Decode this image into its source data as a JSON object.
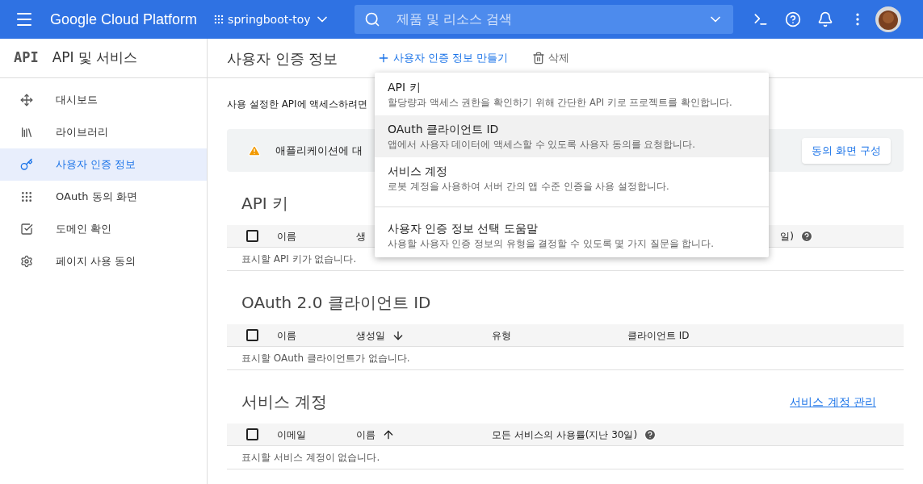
{
  "topbar": {
    "brand": "Google Cloud Platform",
    "project": "springboot-toy",
    "search": {
      "placeholder": "제품 및 리소스 검색"
    }
  },
  "sidebar": {
    "logo": "API",
    "title": "API 및 서비스",
    "items": [
      {
        "label": "대시보드",
        "selected": false
      },
      {
        "label": "라이브러리",
        "selected": false
      },
      {
        "label": "사용자 인증 정보",
        "selected": true
      },
      {
        "label": "OAuth 동의 화면",
        "selected": false
      },
      {
        "label": "도메인 확인",
        "selected": false
      },
      {
        "label": "페이지 사용 동의",
        "selected": false
      }
    ]
  },
  "page": {
    "title": "사용자 인증 정보",
    "actions": [
      {
        "kind": "create",
        "label": "사용자 인증 정보 만들기"
      },
      {
        "kind": "delete",
        "label": "삭제"
      }
    ],
    "intro": "사용 설정한 API에 액세스하려면",
    "banner": {
      "text": "애플리케이션에 대",
      "button": "동의 화면 구성"
    },
    "sections": [
      {
        "title": "API 키",
        "all_selected": false,
        "columns": [
          {
            "label": "이름"
          },
          {
            "label": "생"
          },
          {
            "label": "일)",
            "help": true
          }
        ],
        "empty": "표시할 API 키가 없습니다."
      },
      {
        "title": "OAuth 2.0 클라이언트 ID",
        "all_selected": false,
        "columns": [
          {
            "label": "이름"
          },
          {
            "label": "생성일",
            "sorted": true,
            "descending": true
          },
          {
            "label": "유형"
          },
          {
            "label": "클라이언트 ID"
          }
        ],
        "empty": "표시할 OAuth 클라이언트가 없습니다."
      },
      {
        "title": "서비스 계정",
        "link": "서비스 계정 관리",
        "all_selected": false,
        "columns": [
          {
            "label": "이메일"
          },
          {
            "label": "이름",
            "sorted": true,
            "descending": false
          },
          {
            "label": "모든 서비스의 사용률(지난 30일)",
            "help": true
          }
        ],
        "empty": "표시할 서비스 계정이 없습니다."
      }
    ]
  },
  "menu": {
    "items": [
      {
        "title": "API 키",
        "description": "할당량과 액세스 권한을 확인하기 위해 간단한 API 키로 프로젝트를 확인합니다.",
        "selected": false
      },
      {
        "title": "OAuth 클라이언트 ID",
        "description": "앱에서 사용자 데이터에 액세스할 수 있도록 사용자 동의를 요청합니다.",
        "selected": true
      },
      {
        "title": "서비스 계정",
        "description": "로봇 계정을 사용하여 서버 간의 앱 수준 인증을 사용 설정합니다.",
        "selected": false
      },
      {
        "title": "사용자 인증 정보 선택 도움말",
        "description": "사용할 사용자 인증 정보의 유형을 결정할 수 있도록 몇 가지 질문을 합니다.",
        "selected": false,
        "divider": true
      }
    ]
  }
}
